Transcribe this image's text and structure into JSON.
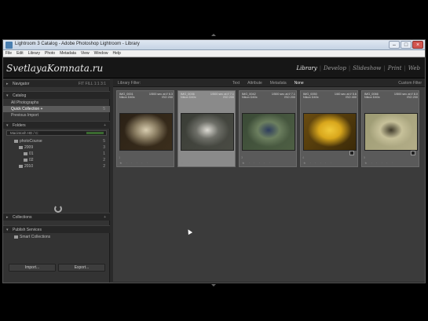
{
  "window": {
    "title": "Lightroom 3 Catalog - Adobe Photoshop Lightroom - Library",
    "controls": [
      "–",
      "□",
      "×"
    ]
  },
  "menu": [
    "File",
    "Edit",
    "Library",
    "Photo",
    "Metadata",
    "View",
    "Window",
    "Help"
  ],
  "identity_plate": "SvetlayaKomnata.ru",
  "modules": [
    {
      "label": "Library",
      "active": true
    },
    {
      "label": "Develop",
      "active": false
    },
    {
      "label": "Slideshow",
      "active": false
    },
    {
      "label": "Print",
      "active": false
    },
    {
      "label": "Web",
      "active": false
    }
  ],
  "left_panel": {
    "navigator": {
      "title": "Navigator",
      "zoom": "FIT  FILL  1:1  3:1"
    },
    "catalog": {
      "title": "Catalog",
      "rows": [
        {
          "label": "All Photographs",
          "count": "",
          "selected": false
        },
        {
          "label": "Quick Collection +",
          "count": "5",
          "selected": true
        },
        {
          "label": "Previous Import",
          "count": "",
          "selected": false
        }
      ]
    },
    "folders": {
      "title": "Folders",
      "volume": "Macintosh HD / C:",
      "rows": [
        {
          "label": "photoCourse",
          "count": "5"
        },
        {
          "label": "2009",
          "count": "3"
        },
        {
          "label": "01",
          "count": "1"
        },
        {
          "label": "02",
          "count": "2"
        },
        {
          "label": "2010",
          "count": "2"
        }
      ]
    },
    "collections": {
      "title": "Collections"
    },
    "publish": {
      "title": "Publish Services",
      "rows": [
        {
          "label": "Smart Collections",
          "count": ""
        }
      ]
    },
    "buttons": {
      "import": "Import...",
      "export": "Export..."
    }
  },
  "grid": {
    "filter_label": "Library Filter:",
    "filter_tabs": [
      {
        "label": "Text",
        "active": false
      },
      {
        "label": "Attribute",
        "active": false
      },
      {
        "label": "Metadata",
        "active": false
      },
      {
        "label": "None",
        "active": true
      }
    ],
    "filter_right": "Custom Filter",
    "cells": [
      {
        "index": "1",
        "name": "IMG_0001",
        "info": "1/500 sec at f/ 6.3",
        "line2": "Nikon D40x",
        "iso": "ISO 200",
        "selected": false,
        "colors": [
          "#2b2116",
          "#8a7d62",
          "#d8cdb0",
          "#3b2e1c"
        ],
        "badge": false
      },
      {
        "index": "2",
        "name": "IMG_0036",
        "info": "1/500 sec at f/ 7.1",
        "line2": "Nikon D40x",
        "iso": "ISO 200",
        "selected": true,
        "colors": [
          "#3a3d36",
          "#6e6f68",
          "#dcdad3",
          "#4a4b44"
        ],
        "badge": false
      },
      {
        "index": "3",
        "name": "IMG_0042",
        "info": "1/500 sec at f/ 7.1",
        "line2": "Nikon D40x",
        "iso": "ISO 200",
        "selected": false,
        "colors": [
          "#3a4a36",
          "#6c7f5f",
          "#2d3c5e",
          "#4e5f44"
        ],
        "badge": false
      },
      {
        "index": "4",
        "name": "IMG_0050",
        "info": "1/60 sec at f/ 5.6",
        "line2": "Nikon D40x",
        "iso": "ISO 400",
        "selected": false,
        "colors": [
          "#6a4c10",
          "#d9a71c",
          "#f0c93a",
          "#3b2a08"
        ],
        "badge": true
      },
      {
        "index": "5",
        "name": "IMG_0066",
        "info": "1/500 sec at f/ 8.0",
        "line2": "Nikon D40x",
        "iso": "ISO 200",
        "selected": false,
        "colors": [
          "#9d9b73",
          "#c7c19a",
          "#3f3a2a",
          "#b3ad88"
        ],
        "badge": true
      }
    ],
    "rating_glyphs": "★ · · · · ·"
  }
}
